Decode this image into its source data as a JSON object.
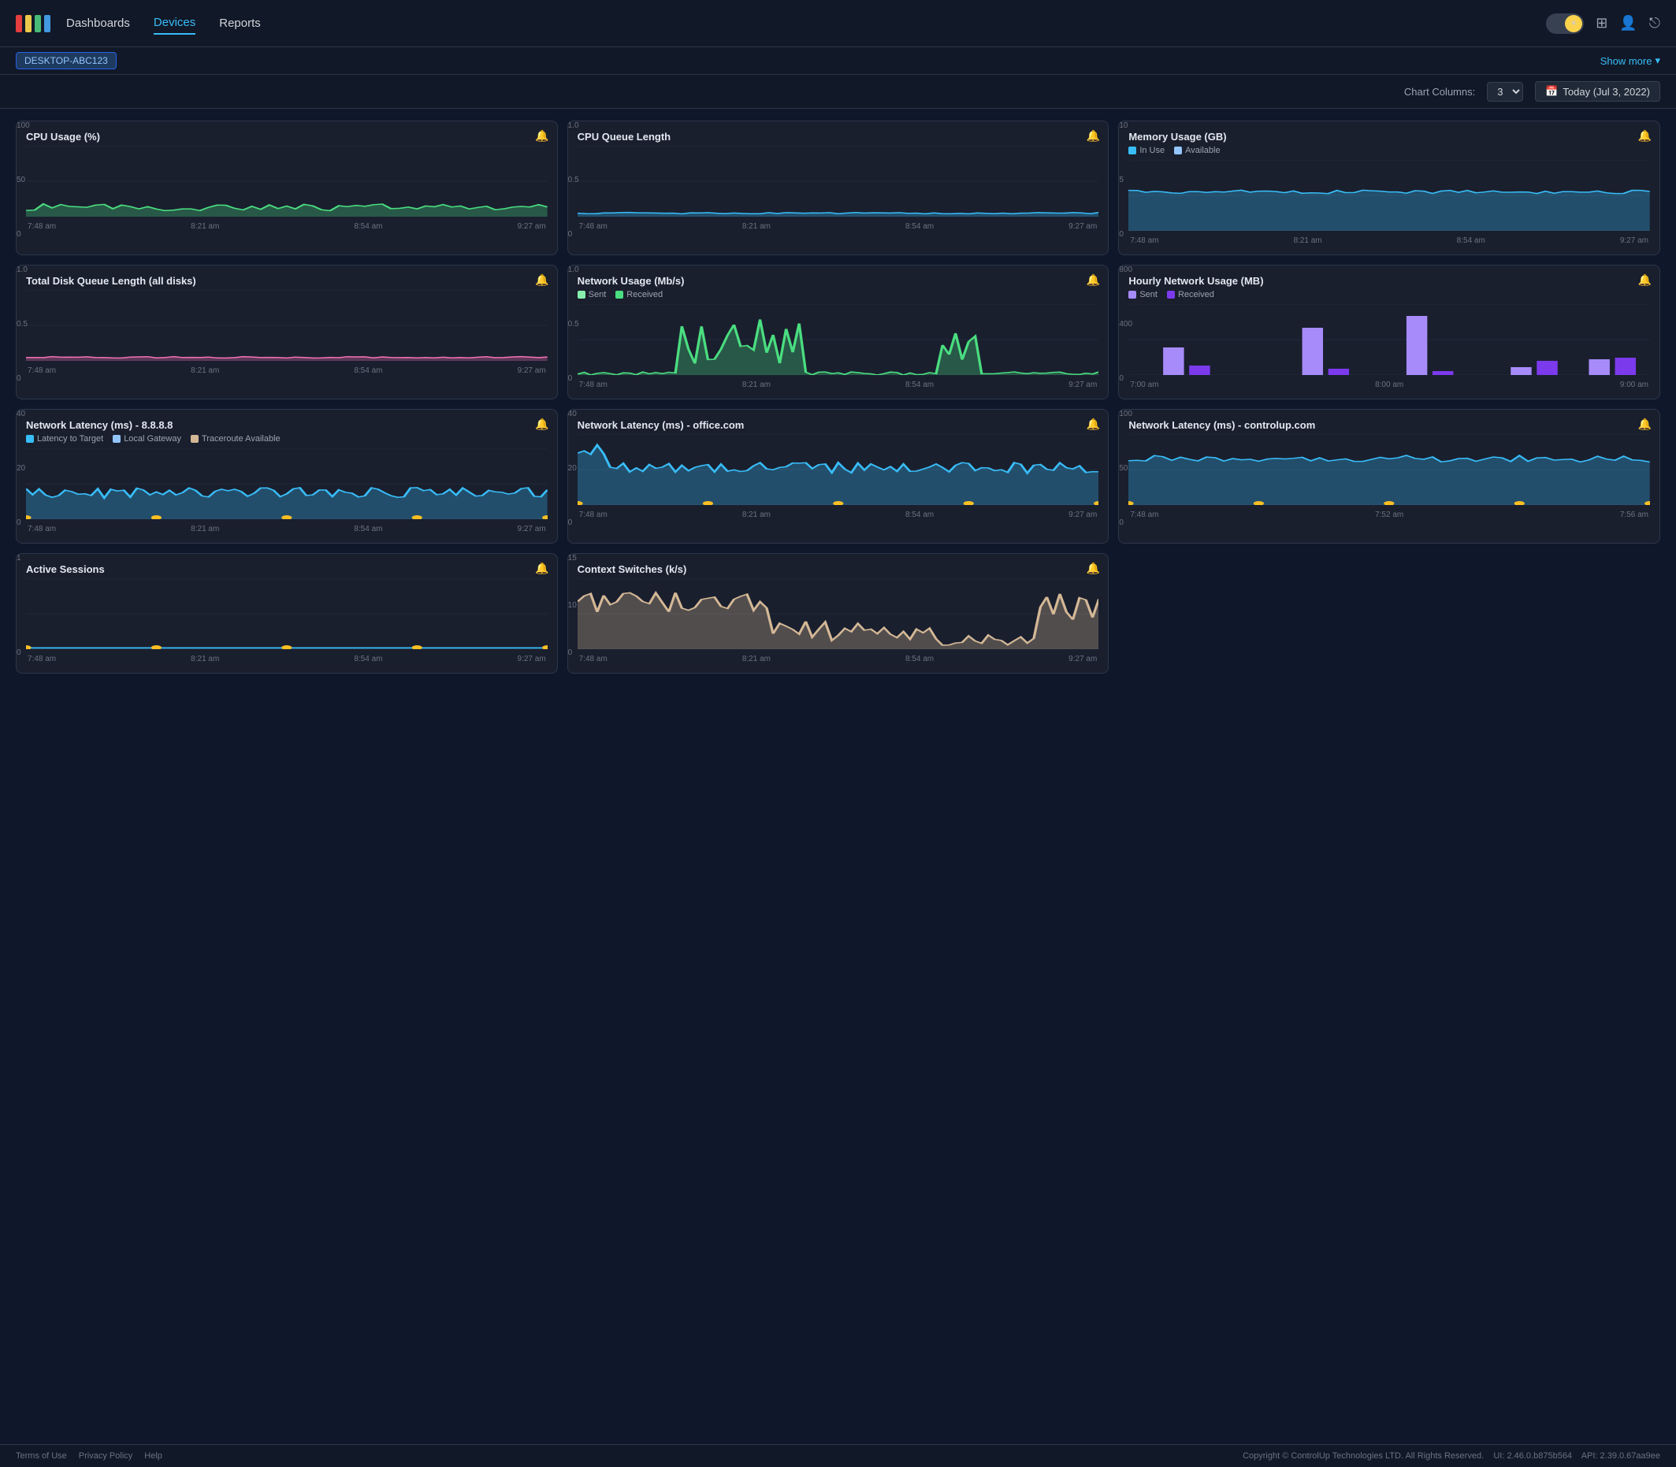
{
  "nav": {
    "dashboards_label": "Dashboards",
    "devices_label": "Devices",
    "reports_label": "Reports",
    "toggle_mode": "light",
    "show_more_label": "Show more"
  },
  "toolbar": {
    "chart_columns_label": "Chart Columns:",
    "chart_columns_value": "3",
    "date_label": "Today (Jul 3, 2022)"
  },
  "device_pill": "DESKTOP-ABC123",
  "charts": [
    {
      "id": "cpu-usage",
      "title": "CPU Usage (%)",
      "y_max": "100",
      "y_mid": "50",
      "y_min": "0",
      "times": [
        "7:48 am",
        "8:21 am",
        "8:54 am",
        "9:27 am"
      ],
      "color": "#4ade80",
      "type": "area",
      "legend": []
    },
    {
      "id": "cpu-queue",
      "title": "CPU Queue Length",
      "y_max": "1.0",
      "y_mid": "0.5",
      "y_min": "0",
      "times": [
        "7:48 am",
        "8:21 am",
        "8:54 am",
        "9:27 am"
      ],
      "color": "#38bdf8",
      "type": "area",
      "legend": []
    },
    {
      "id": "memory-usage",
      "title": "Memory Usage (GB)",
      "y_max": "10",
      "y_mid": "5",
      "y_min": "0",
      "times": [
        "7:48 am",
        "8:21 am",
        "8:54 am",
        "9:27 am"
      ],
      "color": "#38bdf8",
      "type": "area-dual",
      "legend": [
        {
          "label": "In Use",
          "color": "#38bdf8"
        },
        {
          "label": "Available",
          "color": "#93c5fd"
        }
      ]
    },
    {
      "id": "disk-queue",
      "title": "Total Disk Queue Length (all disks)",
      "y_max": "1.0",
      "y_mid": "0.5",
      "y_min": "0",
      "times": [
        "7:48 am",
        "8:21 am",
        "8:54 am",
        "9:27 am"
      ],
      "color": "#f472b6",
      "type": "area",
      "legend": []
    },
    {
      "id": "network-usage",
      "title": "Network Usage (Mb/s)",
      "y_max": "1.0",
      "y_mid": "0.5",
      "y_min": "0",
      "times": [
        "7:48 am",
        "8:21 am",
        "8:54 am",
        "9:27 am"
      ],
      "color": "#4ade80",
      "type": "area-dual",
      "legend": [
        {
          "label": "Sent",
          "color": "#86efac"
        },
        {
          "label": "Received",
          "color": "#4ade80"
        }
      ]
    },
    {
      "id": "hourly-network",
      "title": "Hourly Network Usage (MB)",
      "y_max": "800",
      "y_mid": "400",
      "y_min": "0",
      "times": [
        "7:00 am",
        "8:00 am",
        "9:00 am"
      ],
      "color": "#a78bfa",
      "type": "bar-dual",
      "legend": [
        {
          "label": "Sent",
          "color": "#a78bfa"
        },
        {
          "label": "Received",
          "color": "#7c3aed"
        }
      ]
    },
    {
      "id": "latency-8888",
      "title": "Network Latency (ms) - 8.8.8.8",
      "y_max": "40",
      "y_mid": "20",
      "y_min": "0",
      "times": [
        "7:48 am",
        "8:21 am",
        "8:54 am",
        "9:27 am"
      ],
      "color": "#38bdf8",
      "type": "area",
      "legend": [
        {
          "label": "Latency to Target",
          "color": "#38bdf8"
        },
        {
          "label": "Local Gateway",
          "color": "#93c5fd"
        },
        {
          "label": "Traceroute Available",
          "color": "#d4b896"
        }
      ]
    },
    {
      "id": "latency-office",
      "title": "Network Latency (ms) - office.com",
      "y_max": "40",
      "y_mid": "20",
      "y_min": "0",
      "times": [
        "7:48 am",
        "8:21 am",
        "8:54 am",
        "9:27 am"
      ],
      "color": "#38bdf8",
      "type": "area",
      "legend": []
    },
    {
      "id": "latency-controlup",
      "title": "Network Latency (ms) - controlup.com",
      "y_max": "100",
      "y_mid": "50",
      "y_min": "0",
      "times": [
        "7:48 am",
        "7:52 am",
        "7:56 am"
      ],
      "color": "#38bdf8",
      "type": "area",
      "legend": []
    },
    {
      "id": "active-sessions",
      "title": "Active Sessions",
      "y_max": "1",
      "y_mid": "",
      "y_min": "0",
      "times": [
        "7:48 am",
        "8:21 am",
        "8:54 am",
        "9:27 am"
      ],
      "color": "#38bdf8",
      "type": "area",
      "legend": []
    },
    {
      "id": "context-switches",
      "title": "Context Switches (k/s)",
      "y_max": "15",
      "y_mid": "10",
      "y_min": "0",
      "times": [
        "7:48 am",
        "8:21 am",
        "8:54 am",
        "9:27 am"
      ],
      "color": "#d4b896",
      "type": "area",
      "legend": []
    }
  ],
  "footer": {
    "terms_label": "Terms of Use",
    "privacy_label": "Privacy Policy",
    "help_label": "Help",
    "copyright": "Copyright © ControlUp Technologies LTD. All Rights Reserved.",
    "ui_version": "UI: 2.46.0.b875b564",
    "api_version": "API: 2.39.0.67aa9ee"
  }
}
